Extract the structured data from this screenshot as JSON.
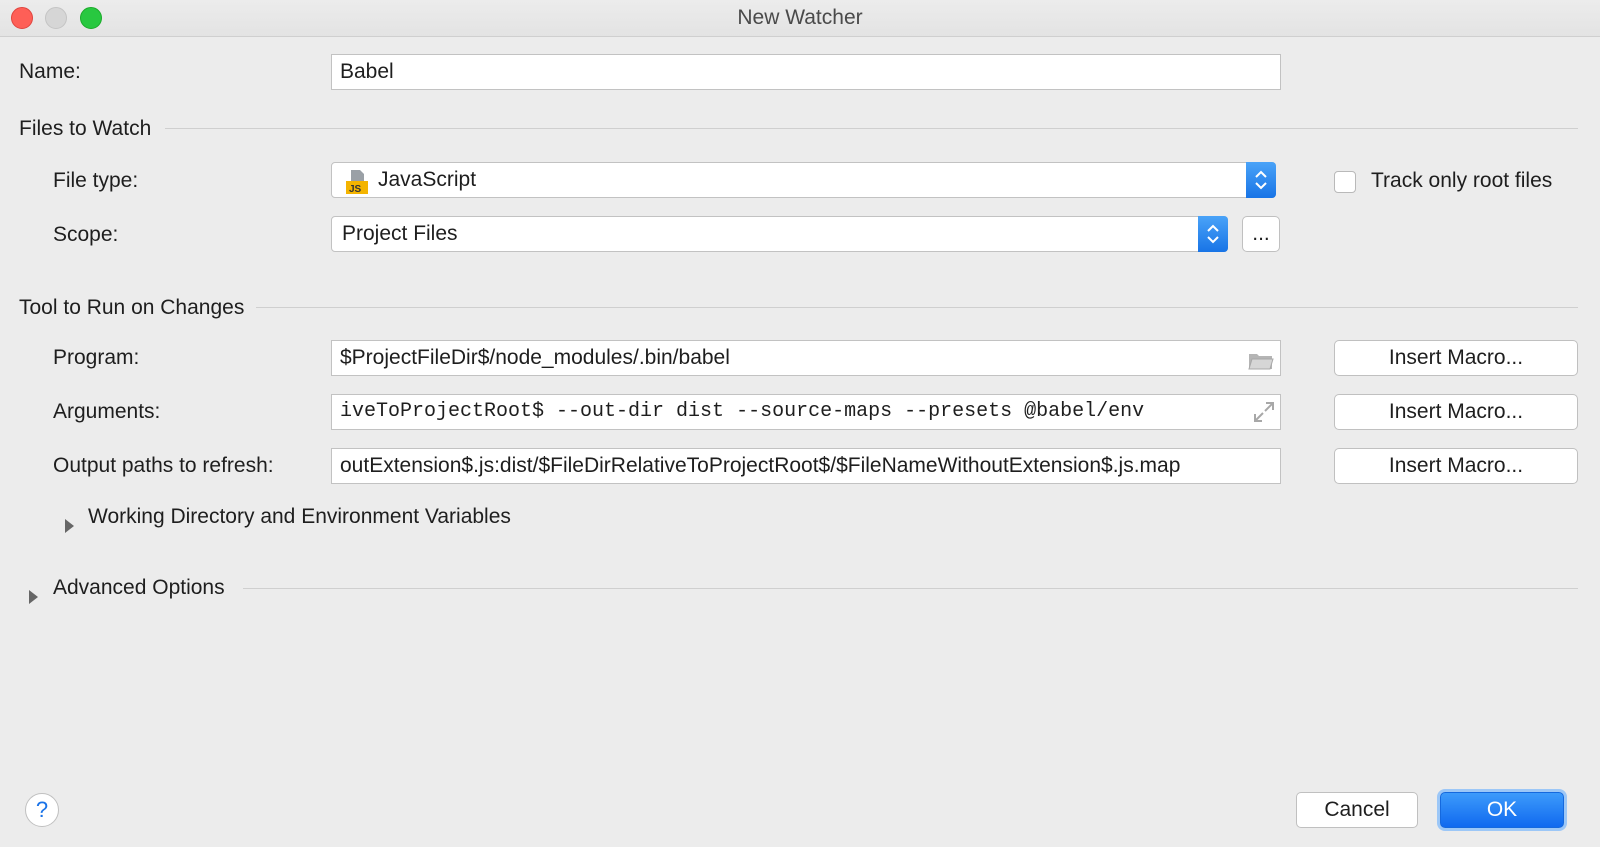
{
  "window": {
    "title": "New Watcher"
  },
  "name": {
    "label": "Name:",
    "value": "Babel"
  },
  "files_to_watch": {
    "title": "Files to Watch",
    "file_type": {
      "label": "File type:",
      "value": "JavaScript",
      "icon": "js-file-icon"
    },
    "track_root": {
      "label": "Track only root files",
      "checked": false
    },
    "scope": {
      "label": "Scope:",
      "value": "Project Files",
      "more_label": "..."
    }
  },
  "tool": {
    "title": "Tool to Run on Changes",
    "program": {
      "label": "Program:",
      "value": "$ProjectFileDir$/node_modules/.bin/babel"
    },
    "arguments": {
      "label": "Arguments:",
      "value": "iveToProjectRoot$ --out-dir dist --source-maps --presets @babel/env"
    },
    "output": {
      "label": "Output paths to refresh:",
      "value": "outExtension$.js:dist/$FileDirRelativeToProjectRoot$/$FileNameWithoutExtension$.js.map"
    },
    "insert_macro_label": "Insert Macro...",
    "working_dir_label": "Working Directory and Environment Variables"
  },
  "advanced": {
    "label": "Advanced Options"
  },
  "footer": {
    "help_label": "?",
    "cancel_label": "Cancel",
    "ok_label": "OK"
  },
  "colors": {
    "accent": "#1a73e8",
    "background": "#ececec"
  }
}
